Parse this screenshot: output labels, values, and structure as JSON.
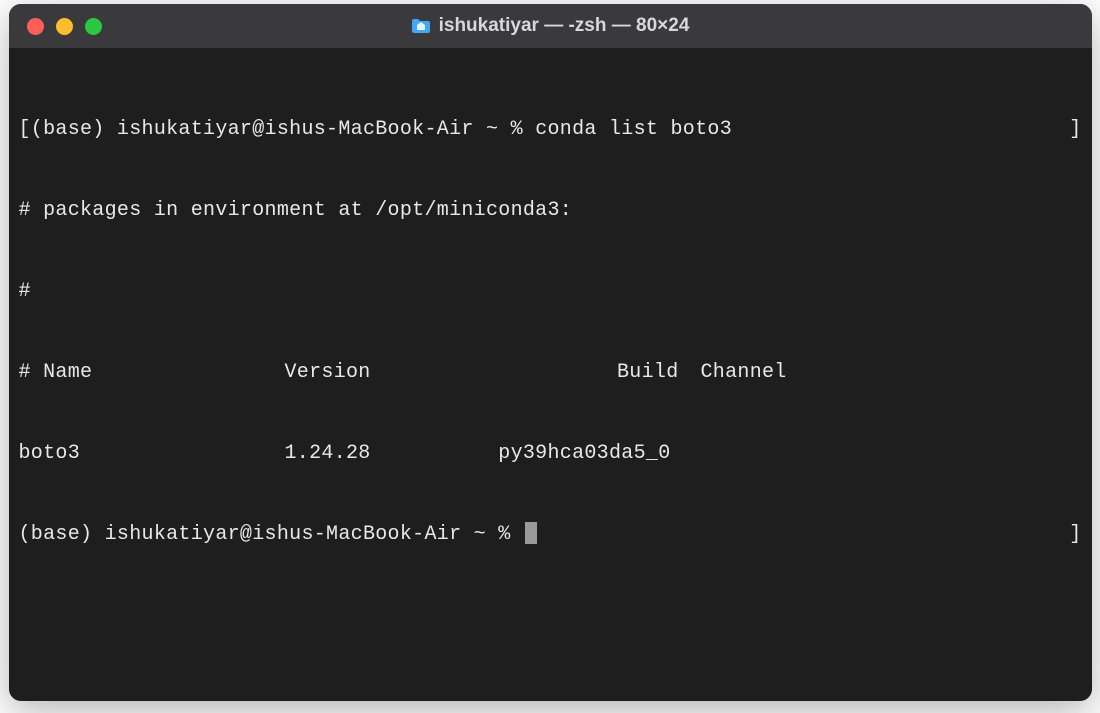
{
  "window": {
    "title": "ishukatiyar — -zsh — 80×24"
  },
  "terminal": {
    "prompt1_full": "[(base) ishukatiyar@ishus-MacBook-Air ~ % ",
    "command1": "conda list boto3",
    "hash_env": "# packages in environment at /opt/miniconda3:",
    "hash_blank": "#",
    "header": {
      "name": "# Name",
      "version": "Version",
      "build": "Build",
      "channel": "Channel"
    },
    "row": {
      "name": "boto3",
      "version": "1.24.28",
      "build": "py39hca03da5_0",
      "channel": ""
    },
    "prompt2_full": "(base) ishukatiyar@ishus-MacBook-Air ~ % ",
    "bracket_right": "]"
  }
}
